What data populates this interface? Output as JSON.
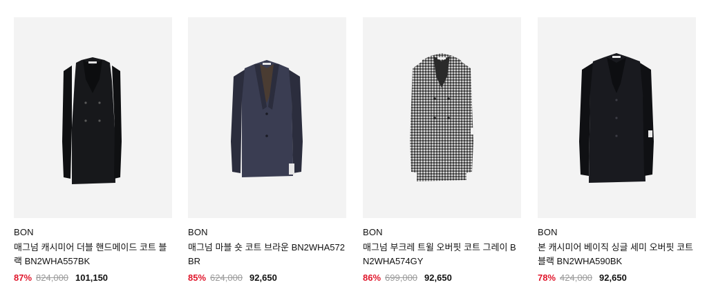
{
  "products": [
    {
      "brand": "BON",
      "name": "매그넘 캐시미어 더블 핸드메이드 코트 블랙 BN2WHA557BK",
      "discount_rate": "87%",
      "original_price": "824,000",
      "sale_price": "101,150",
      "colors": {
        "body": "#17181b",
        "shade": "#0c0d0f"
      }
    },
    {
      "brand": "BON",
      "name": "매그넘 마블 숏 코트 브라운 BN2WHA572BR",
      "discount_rate": "85%",
      "original_price": "624,000",
      "sale_price": "92,650",
      "colors": {
        "body": "#3a3d52",
        "shade": "#2b2d3d"
      }
    },
    {
      "brand": "BON",
      "name": "매그넘 부크레 트윌 오버핏 코트 그레이 BN2WHA574GY",
      "discount_rate": "86%",
      "original_price": "699,000",
      "sale_price": "92,650",
      "colors": {
        "body": "#8a8a8a",
        "shade": "#505050"
      }
    },
    {
      "brand": "BON",
      "name": "본 캐시미어 베이직 싱글 세미 오버핏 코트 블랙 BN2WHA590BK",
      "discount_rate": "78%",
      "original_price": "424,000",
      "sale_price": "92,650",
      "colors": {
        "body": "#191a1f",
        "shade": "#0d0e11"
      }
    }
  ],
  "theme": {
    "discount_color": "#e0162b",
    "thumb_bg": "#f3f3f3",
    "muted": "#9a9a9a"
  }
}
